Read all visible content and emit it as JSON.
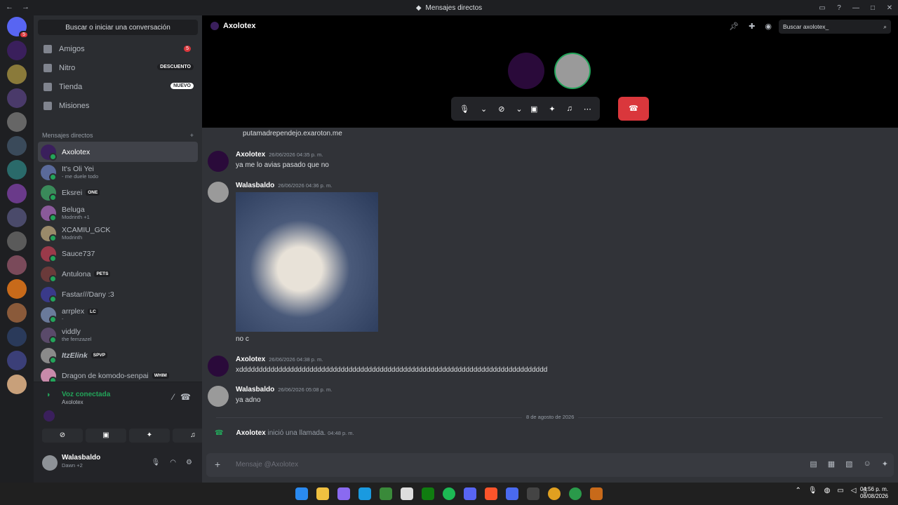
{
  "window": {
    "title": "Mensajes directos"
  },
  "servers": {
    "badge_count": "5"
  },
  "sidebar": {
    "search_label": "Buscar o iniciar una conversación",
    "nav": [
      {
        "label": "Amigos",
        "badge": "5"
      },
      {
        "label": "Nitro",
        "tag": "DESCUENTO"
      },
      {
        "label": "Tienda",
        "tag": "NUEVO"
      },
      {
        "label": "Misiones"
      }
    ],
    "dm_header": "Mensajes directos",
    "dm_add": "+",
    "dms": [
      {
        "name": "Axolotex",
        "status": "",
        "pill": ""
      },
      {
        "name": "It's Oli Yei",
        "status": "- me duele todo",
        "pill": ""
      },
      {
        "name": "Eksrei",
        "status": "",
        "pill": "ONE"
      },
      {
        "name": "Beluga",
        "status": "Modrinth +1",
        "pill": ""
      },
      {
        "name": "XCAMIU_GCK",
        "status": "Modrinth",
        "pill": ""
      },
      {
        "name": "Sauce737",
        "status": "",
        "pill": ""
      },
      {
        "name": "Antulona",
        "status": "",
        "pill": "PETS"
      },
      {
        "name": "Fastar///Dany :3",
        "status": "",
        "pill": ""
      },
      {
        "name": "arrplex",
        "status": "-",
        "pill": "LC"
      },
      {
        "name": "viddly",
        "status": "the femzazel",
        "pill": ""
      },
      {
        "name": "ItzElink",
        "status": "",
        "pill": "SPVP"
      },
      {
        "name": "Dragon de komodo-senpai",
        "status": "",
        "pill": "WHIM"
      }
    ]
  },
  "voice": {
    "title": "Voz conectada",
    "subtitle": "Axolotex"
  },
  "user": {
    "name": "Walasbaldo",
    "status": "Dawn +2"
  },
  "channel": {
    "name": "Axolotex",
    "search_placeholder": "Buscar axolotex_"
  },
  "messages": [
    {
      "text": "putamadrependejo.exaroton.me"
    },
    {
      "author": "Axolotex",
      "time": "26/06/2026 04:35 p. m.",
      "text": "ya me lo avias pasado que no"
    },
    {
      "author": "Walasbaldo",
      "time": "26/06/2026 04:36 p. m.",
      "text": "no c"
    },
    {
      "author": "Axolotex",
      "time": "26/06/2026 04:38 p. m.",
      "text": "xddddddddddddddddddddddddddddddddddddddddddddddddddddddddddddddddddddddddddddddd"
    },
    {
      "author": "Walasbaldo",
      "time": "26/06/2026 05:08 p. m.",
      "text": "ya adno"
    }
  ],
  "date_divider": "8 de agosto de 2026",
  "call_event": {
    "author": "Axolotex",
    "text": "inició una llamada.",
    "time": "04:48 p. m."
  },
  "composer": {
    "placeholder": "Mensaje @Axolotex"
  },
  "taskbar": {
    "time": "04:56 p. m.",
    "date": "08/08/2026"
  }
}
